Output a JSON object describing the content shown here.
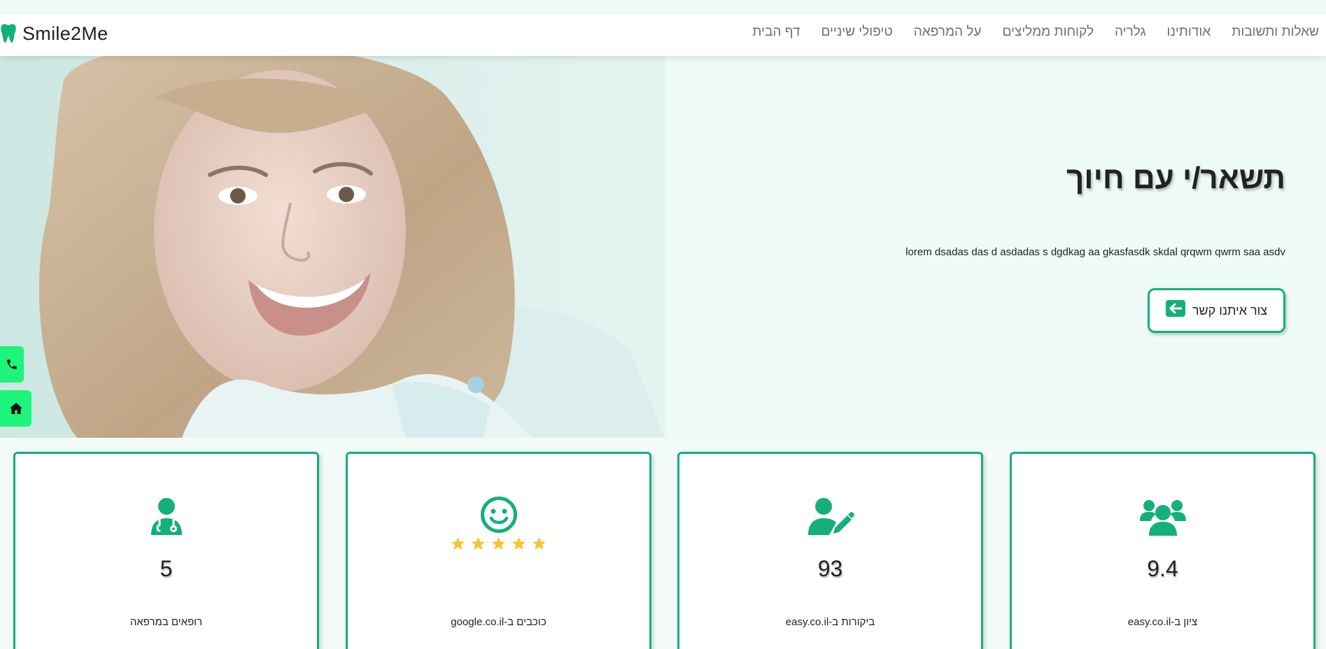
{
  "brand": {
    "name": "Smile2Me",
    "icon": "tooth-icon",
    "accent": "#13b07a"
  },
  "nav": {
    "items": [
      "דף הבית",
      "טיפולי שיניים",
      "על המרפאה",
      "לקוחות ממליצים",
      "גלריה",
      "אודותינו",
      "שאלות ותשובות"
    ]
  },
  "hero": {
    "title": "תשאר/י עם חיוך",
    "text": "lorem dsadas das d asdadas s dgdkag aa gkasfasdk skdal qrqwm qwrm saa asdv",
    "cta_label": "צור איתנו קשר",
    "cta_icon": "arrow-left-icon",
    "image": "smiling-woman-photo"
  },
  "side_buttons": [
    {
      "icon": "phone-icon",
      "color": "#1ef47a"
    },
    {
      "icon": "home-icon",
      "color": "#1ef47a"
    }
  ],
  "stats": [
    {
      "value": "5",
      "label": "רופאים במרפאה",
      "icon": "doctor-icon"
    },
    {
      "value": "",
      "label": "כוכבים ב-google.co.il",
      "icon": "smile-icon",
      "stars": 5,
      "star_color": "#f7c431"
    },
    {
      "value": "93",
      "label": "ביקורות ב-easy.co.il",
      "icon": "user-edit-icon"
    },
    {
      "value": "9.4",
      "label": "ציון ב-easy.co.il",
      "icon": "users-icon"
    }
  ]
}
